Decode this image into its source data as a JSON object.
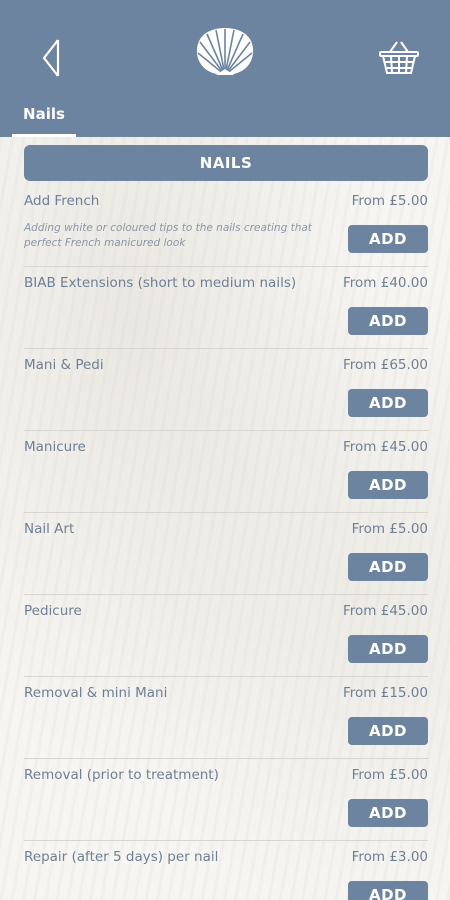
{
  "header": {
    "back_icon": "back-chevron-icon",
    "logo_icon": "seashell-icon",
    "cart_icon": "basket-icon",
    "tab_label": "Nails",
    "colors": {
      "bar": "#6c84a0",
      "text": "#ffffff"
    }
  },
  "section": {
    "title": "NAILS"
  },
  "services": [
    {
      "name": "Add French",
      "price": "From £5.00",
      "description": "Adding white or coloured tips to the nails creating that perfect French manicured look",
      "button": "ADD"
    },
    {
      "name": "BIAB Extensions (short to medium nails)",
      "price": "From £40.00",
      "button": "ADD"
    },
    {
      "name": "Mani & Pedi",
      "price": "From £65.00",
      "button": "ADD"
    },
    {
      "name": "Manicure",
      "price": "From £45.00",
      "button": "ADD"
    },
    {
      "name": "Nail Art",
      "price": "From £5.00",
      "button": "ADD"
    },
    {
      "name": "Pedicure",
      "price": "From £45.00",
      "button": "ADD"
    },
    {
      "name": "Removal & mini Mani",
      "price": "From £15.00",
      "button": "ADD"
    },
    {
      "name": "Removal (prior to treatment)",
      "price": "From £5.00",
      "button": "ADD"
    },
    {
      "name": "Repair (after 5 days) per nail",
      "price": "From £3.00",
      "button": "ADD"
    }
  ]
}
